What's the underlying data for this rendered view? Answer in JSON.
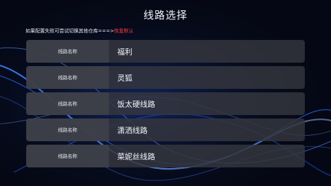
{
  "header": {
    "title": "线路选择"
  },
  "hint": {
    "text": "如果配置失败可尝试切换其他仓库===>",
    "reset_label": "恢复默认"
  },
  "routes": [
    {
      "label": "线路名称",
      "name": "福利"
    },
    {
      "label": "线路名称",
      "name": "灵狐"
    },
    {
      "label": "线路名称",
      "name": "饭太硬线路"
    },
    {
      "label": "线路名称",
      "name": "潇洒线路"
    },
    {
      "label": "线路名称",
      "name": "菜妮丝线路"
    }
  ],
  "colors": {
    "background": "#050814",
    "accent_blue": "#2f6bff",
    "reset_red": "#ff3b3b",
    "row_bg": "#34363e"
  }
}
